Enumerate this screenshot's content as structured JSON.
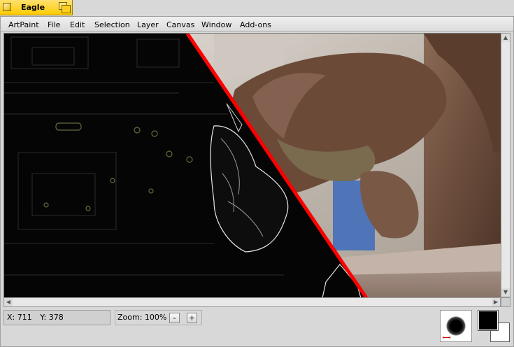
{
  "window": {
    "title": "Eagle"
  },
  "menu": [
    "ArtPaint",
    "File",
    "Edit",
    "Selection",
    "Layer",
    "Canvas",
    "Window",
    "Add-ons"
  ],
  "status": {
    "x": "X: 711",
    "y": "Y: 378",
    "zoom_label": "Zoom: 100%",
    "zoom_out": "-",
    "zoom_in": "+"
  },
  "colors": {
    "foreground": "#000000",
    "background": "#ffffff",
    "divider": "#ff0000",
    "tab": "#ffcb00"
  },
  "icons": {
    "close": "close-box-icon",
    "zoom": "zoom-box-icon",
    "brush": "brush-preview-icon"
  }
}
